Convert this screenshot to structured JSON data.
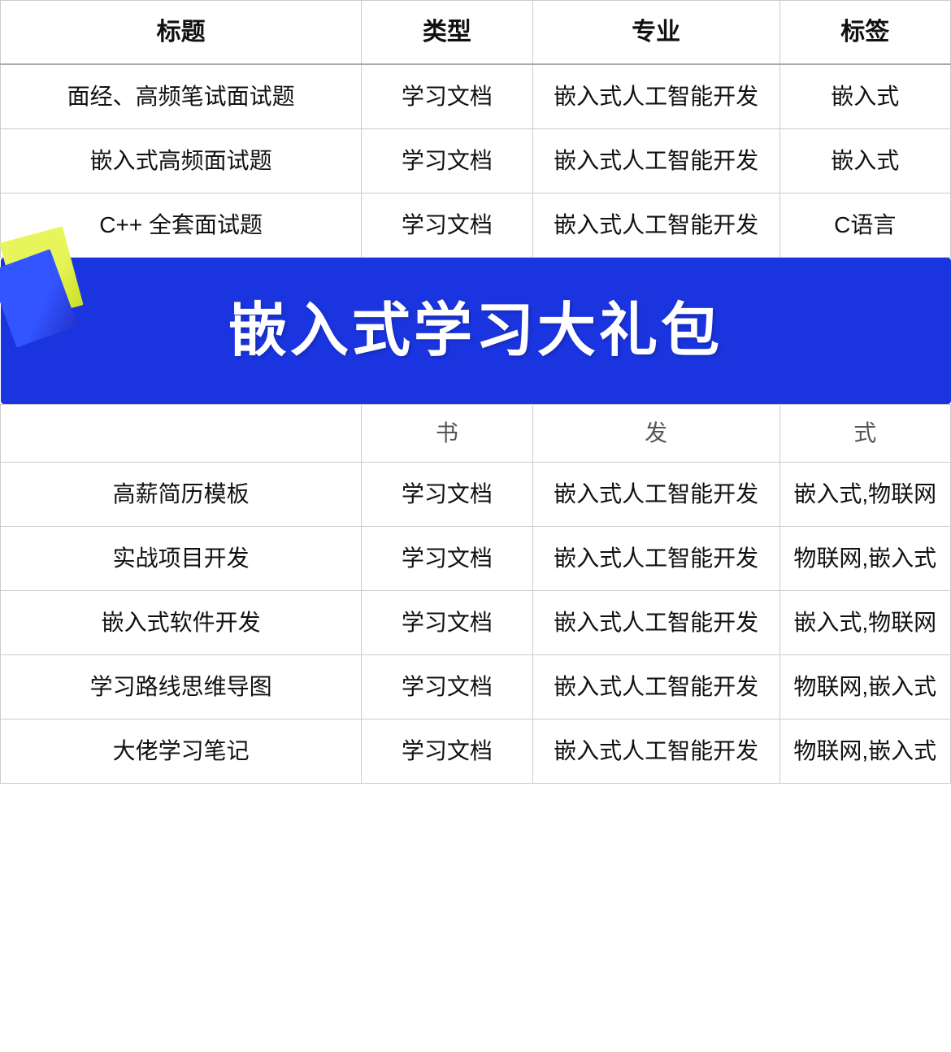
{
  "table": {
    "headers": [
      "标题",
      "类型",
      "专业",
      "标签"
    ],
    "banner_text": "嵌入式学习大礼包",
    "rows_before_banner": [
      {
        "title": "面经、高频笔试面试题",
        "type": "学习文档",
        "major": "嵌入式人工智能开发",
        "tag": "嵌入式"
      },
      {
        "title": "嵌入式高频面试题",
        "type": "学习文档",
        "major": "嵌入式人工智能开发",
        "tag": "嵌入式"
      },
      {
        "title": "C++ 全套面试题",
        "type": "学习文档",
        "major": "嵌入式人工智能开发",
        "tag": "C语言"
      }
    ],
    "partial_row": {
      "col2": "书",
      "col3": "发",
      "col4": "式"
    },
    "rows_after_banner": [
      {
        "title": "高薪简历模板",
        "type": "学习文档",
        "major": "嵌入式人工智能开发",
        "tag": "嵌入式,物联网"
      },
      {
        "title": "实战项目开发",
        "type": "学习文档",
        "major": "嵌入式人工智能开发",
        "tag": "物联网,嵌入式"
      },
      {
        "title": "嵌入式软件开发",
        "type": "学习文档",
        "major": "嵌入式人工智能开发",
        "tag": "嵌入式,物联网"
      },
      {
        "title": "学习路线思维导图",
        "type": "学习文档",
        "major": "嵌入式人工智能开发",
        "tag": "物联网,嵌入式"
      },
      {
        "title": "大佬学习笔记",
        "type": "学习文档",
        "major": "嵌入式人工智能开发",
        "tag": "物联网,嵌入式"
      }
    ]
  }
}
